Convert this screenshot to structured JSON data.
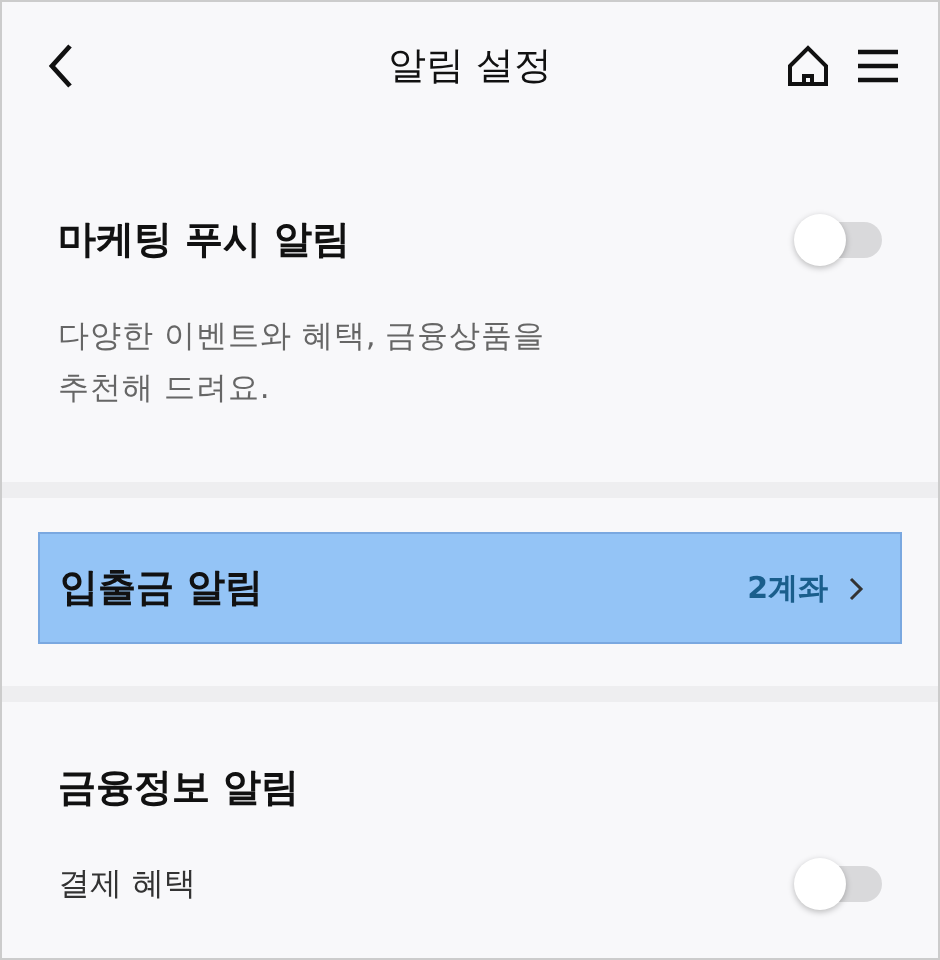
{
  "header": {
    "title": "알림 설정"
  },
  "marketing": {
    "title": "마케팅 푸시 알림",
    "on": false,
    "description": "다양한 이벤트와 혜택, 금융상품을\n추천해 드려요."
  },
  "deposit_alert": {
    "label": "입출금 알림",
    "value": "2계좌",
    "selected": true
  },
  "financial_info": {
    "title": "금융정보 알림",
    "items": [
      {
        "label": "결제 혜택",
        "on": false
      }
    ]
  }
}
